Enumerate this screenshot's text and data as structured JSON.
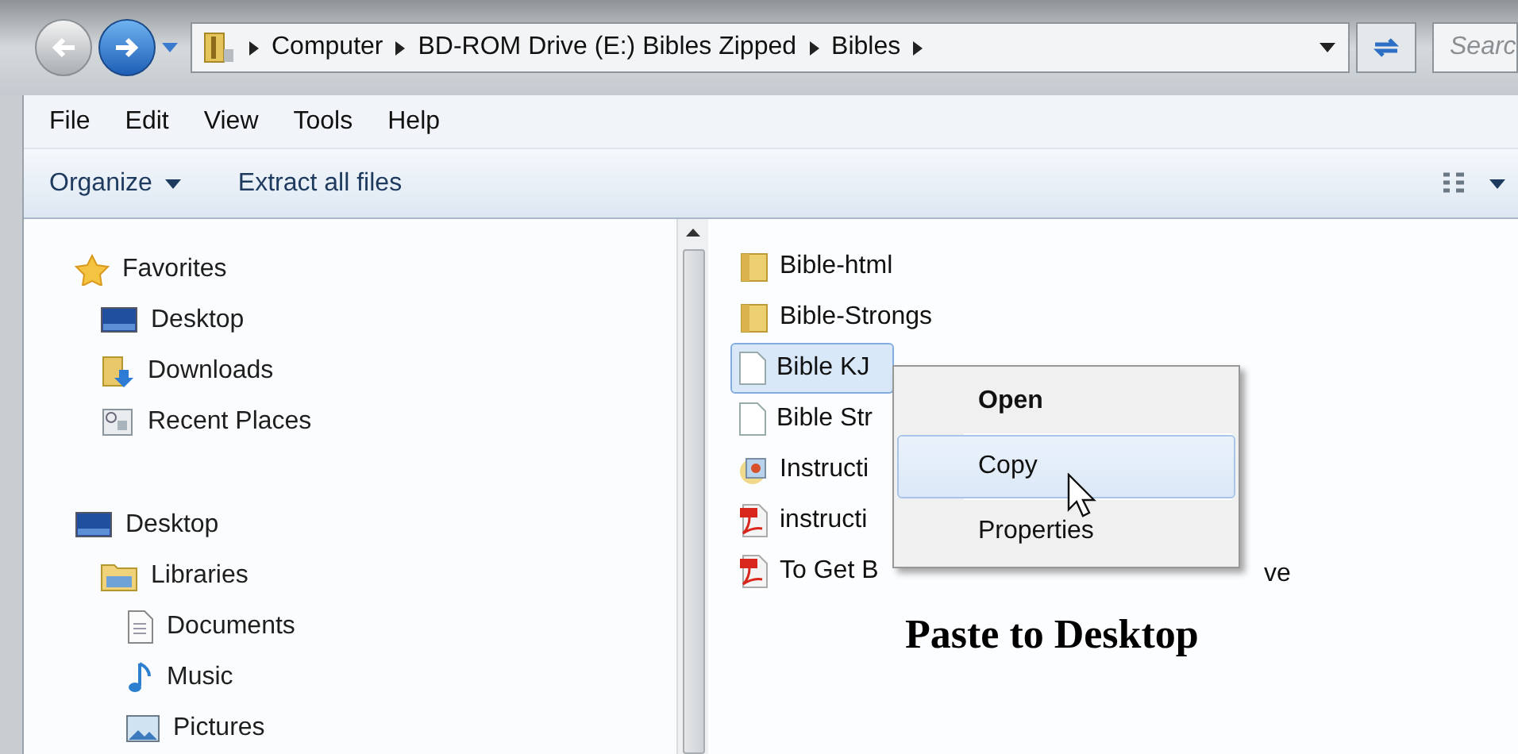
{
  "address_bar": {
    "segments": [
      "Computer",
      "BD-ROM Drive (E:) Bibles Zipped",
      "Bibles"
    ]
  },
  "search": {
    "placeholder": "Searc"
  },
  "menu_bar": [
    "File",
    "Edit",
    "View",
    "Tools",
    "Help"
  ],
  "toolbar": [
    {
      "label": "Organize",
      "kind": "dropdown"
    },
    {
      "label": "Extract all files",
      "kind": "button"
    }
  ],
  "nav_tree": [
    {
      "label": "Favorites",
      "kind": "star",
      "children": [
        {
          "label": "Desktop",
          "kind": "desktop"
        },
        {
          "label": "Downloads",
          "kind": "downloads"
        },
        {
          "label": "Recent Places",
          "kind": "recent"
        }
      ]
    },
    {
      "label": "Desktop",
      "kind": "desktop",
      "children": [
        {
          "label": "Libraries",
          "kind": "library",
          "children": [
            {
              "label": "Documents",
              "kind": "documents"
            },
            {
              "label": "Music",
              "kind": "music"
            },
            {
              "label": "Pictures",
              "kind": "pictures"
            }
          ]
        }
      ]
    }
  ],
  "files": [
    {
      "name": "Bible-html",
      "kind": "folder",
      "selected": false
    },
    {
      "name": "Bible-Strongs",
      "kind": "folder",
      "selected": false
    },
    {
      "name": "Bible KJ",
      "kind": "file",
      "selected": true
    },
    {
      "name": "Bible Str",
      "kind": "file",
      "selected": false
    },
    {
      "name": "Instructi",
      "kind": "image",
      "selected": false
    },
    {
      "name": "instructi",
      "kind": "pdf",
      "selected": false
    },
    {
      "name": "To Get B",
      "tail": "ve",
      "kind": "pdf",
      "selected": false
    }
  ],
  "context_menu": [
    {
      "label": "Open",
      "default": true,
      "selected": false
    },
    {
      "label": "Copy",
      "default": false,
      "selected": true
    },
    {
      "label": "Properties",
      "default": false,
      "selected": false
    }
  ],
  "caption": "Paste to Desktop"
}
